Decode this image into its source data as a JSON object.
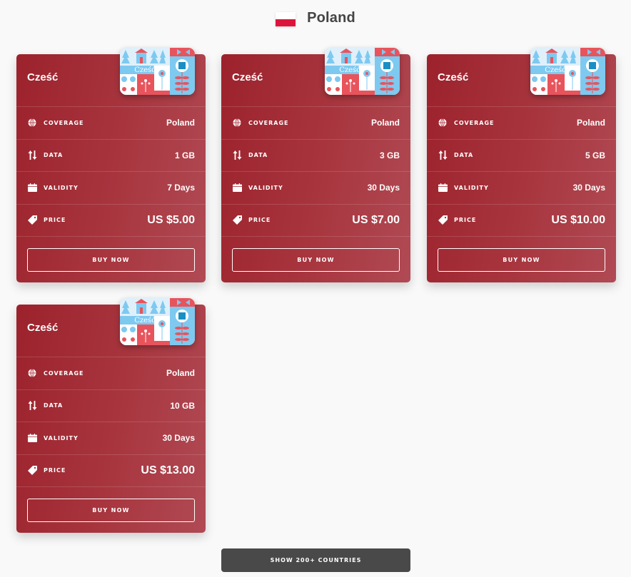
{
  "header": {
    "flag_icon": "poland-flag-icon",
    "country": "Poland",
    "flag_colors": [
      "#ffffff",
      "#dc143c"
    ]
  },
  "labels": {
    "coverage": "COVERAGE",
    "data": "DATA",
    "validity": "VALIDITY",
    "price": "PRICE",
    "buy": "BUY NOW"
  },
  "plans": [
    {
      "title": "Cześć",
      "sim_text": "Cześć",
      "coverage": "Poland",
      "data": "1 GB",
      "validity": "7 Days",
      "price": "US $5.00"
    },
    {
      "title": "Cześć",
      "sim_text": "Cześć",
      "coverage": "Poland",
      "data": "3 GB",
      "validity": "30 Days",
      "price": "US $7.00"
    },
    {
      "title": "Cześć",
      "sim_text": "Cześć",
      "coverage": "Poland",
      "data": "5 GB",
      "validity": "30 Days",
      "price": "US $10.00"
    },
    {
      "title": "Cześć",
      "sim_text": "Cześć",
      "coverage": "Poland",
      "data": "10 GB",
      "validity": "30 Days",
      "price": "US $13.00"
    }
  ],
  "footer": {
    "show_more": "SHOW 200+ COUNTRIES"
  },
  "colors": {
    "card_start": "#9c222c",
    "card_end": "#b04a54",
    "button_dark": "#494949"
  }
}
